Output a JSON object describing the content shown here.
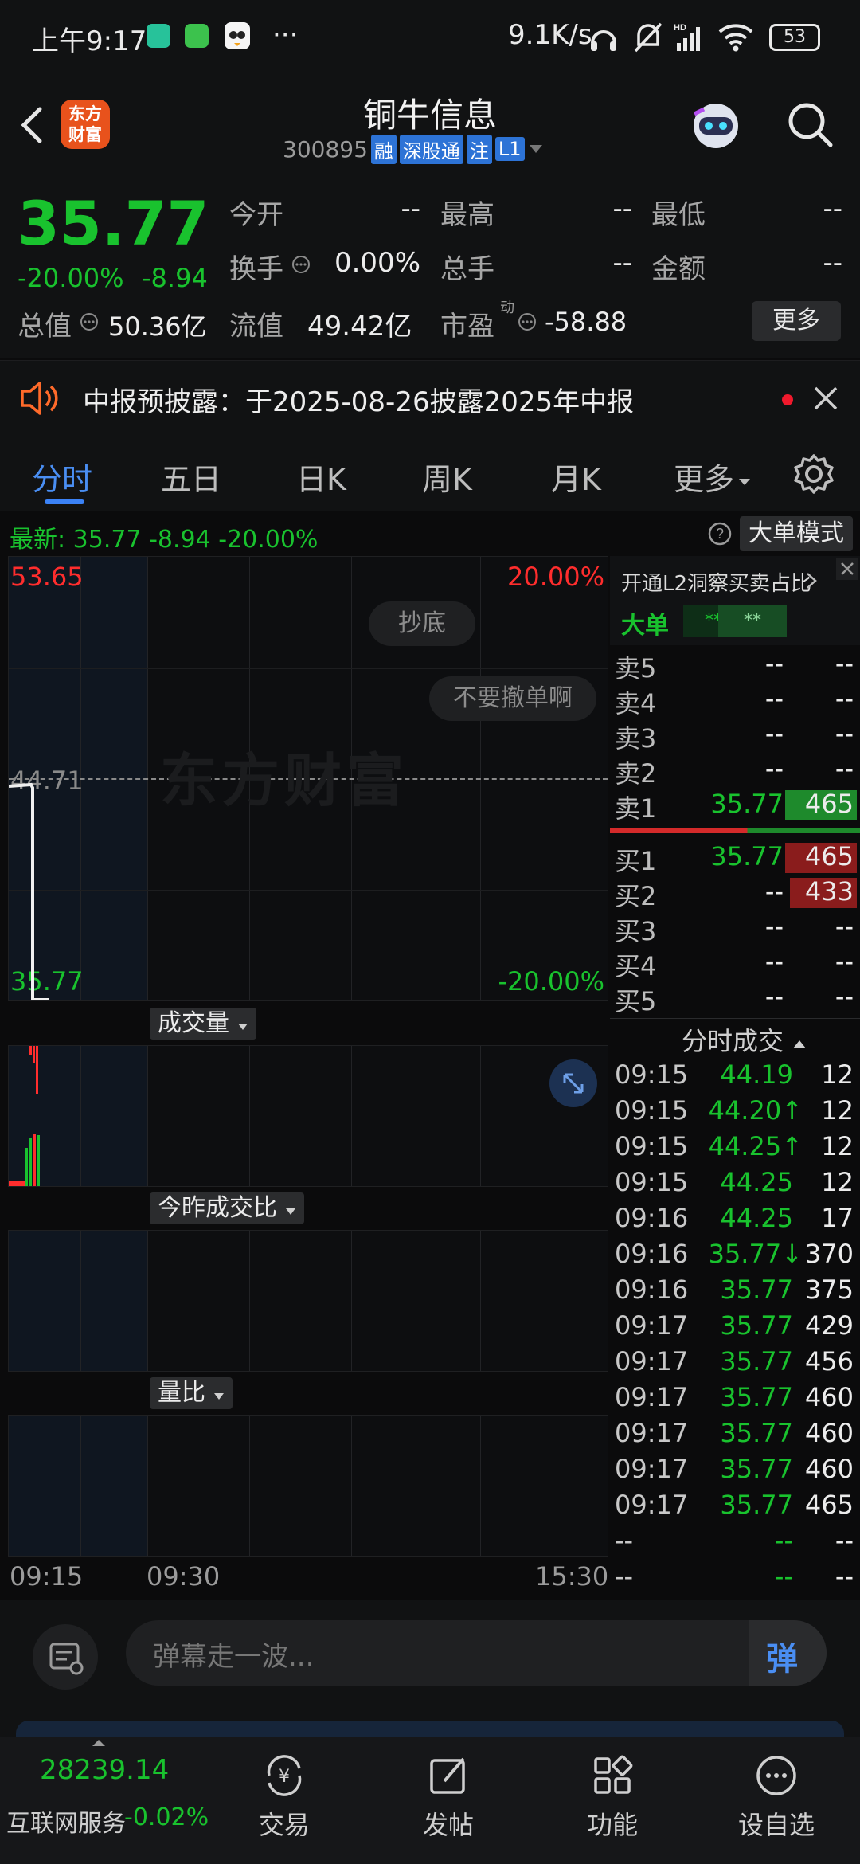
{
  "status": {
    "time": "上午9:17",
    "net_speed": "9.1K/s",
    "battery": "53",
    "dots": "···"
  },
  "header": {
    "stock_name": "铜牛信息",
    "code": "300895",
    "tags": [
      "融",
      "深股通",
      "注",
      "L1"
    ],
    "logo_line1": "东方",
    "logo_line2": "财富"
  },
  "quote": {
    "price": "35.77",
    "change_pct": "-20.00%",
    "change": "-8.94",
    "open_label": "今开",
    "open": "--",
    "high_label": "最高",
    "high": "--",
    "low_label": "最低",
    "low": "--",
    "turnover_label": "换手",
    "turnover": "0.00%",
    "volume_label": "总手",
    "volume": "--",
    "amount_label": "金额",
    "amount": "--",
    "mktcap_label": "总值",
    "mktcap": "50.36亿",
    "float_label": "流值",
    "float": "49.42亿",
    "pe_label": "市盈",
    "pe_sup": "动",
    "pe": "-58.88",
    "more": "更多"
  },
  "notice": {
    "text": "中报预披露：于2025-08-26披露2025年中报"
  },
  "tabs": [
    "分时",
    "五日",
    "日K",
    "周K",
    "月K",
    "更多"
  ],
  "latest": {
    "text": "最新: 35.77  -8.94  -20.00%",
    "big_order_mode": "大单模式"
  },
  "chart": {
    "top_price": "53.65",
    "top_pct": "20.00%",
    "mid_price": "44.71",
    "bottom_price": "35.77",
    "bottom_pct": "-20.00%",
    "watermark": "东方财富",
    "danmu1": "抄底",
    "danmu2": "不要撤单啊",
    "volume_btn": "成交量",
    "ratio_btn": "今昨成交比",
    "qrr_btn": "量比",
    "time_start": "09:15",
    "time_mid": "09:30",
    "time_end": "15:30",
    "colors": {
      "up": "#ff2d2d",
      "down": "#19c22e"
    }
  },
  "book": {
    "l2_link": "开通L2洞察买卖占比",
    "big_single": "大单",
    "big_v1": "**",
    "big_v2": "**",
    "sells": [
      {
        "label": "卖5",
        "price": "--",
        "vol": "--"
      },
      {
        "label": "卖4",
        "price": "--",
        "vol": "--"
      },
      {
        "label": "卖3",
        "price": "--",
        "vol": "--"
      },
      {
        "label": "卖2",
        "price": "--",
        "vol": "--"
      },
      {
        "label": "卖1",
        "price": "35.77",
        "vol": "465"
      }
    ],
    "buys": [
      {
        "label": "买1",
        "price": "35.77",
        "vol": "465"
      },
      {
        "label": "买2",
        "price": "--",
        "vol": "433"
      },
      {
        "label": "买3",
        "price": "--",
        "vol": "--"
      },
      {
        "label": "买4",
        "price": "--",
        "vol": "--"
      },
      {
        "label": "买5",
        "price": "--",
        "vol": "--"
      }
    ],
    "ticks_title": "分时成交",
    "ticks": [
      {
        "t": "09:15",
        "p": "44.19",
        "v": "12"
      },
      {
        "t": "09:15",
        "p": "44.20↑",
        "v": "12"
      },
      {
        "t": "09:15",
        "p": "44.25↑",
        "v": "12"
      },
      {
        "t": "09:15",
        "p": "44.25",
        "v": "12"
      },
      {
        "t": "09:16",
        "p": "44.25",
        "v": "17"
      },
      {
        "t": "09:16",
        "p": "35.77↓",
        "v": "370"
      },
      {
        "t": "09:16",
        "p": "35.77",
        "v": "375"
      },
      {
        "t": "09:17",
        "p": "35.77",
        "v": "429"
      },
      {
        "t": "09:17",
        "p": "35.77",
        "v": "456"
      },
      {
        "t": "09:17",
        "p": "35.77",
        "v": "460"
      },
      {
        "t": "09:17",
        "p": "35.77",
        "v": "460"
      },
      {
        "t": "09:17",
        "p": "35.77",
        "v": "460"
      },
      {
        "t": "09:17",
        "p": "35.77",
        "v": "465"
      },
      {
        "t": "--",
        "p": "--",
        "v": "--"
      },
      {
        "t": "--",
        "p": "--",
        "v": "--"
      }
    ]
  },
  "danmu": {
    "placeholder": "弹幕走一波...",
    "send": "弹"
  },
  "bottom": {
    "index_value": "28239.14",
    "index_name": "互联网服务",
    "index_change": "-0.02%",
    "nav": [
      "交易",
      "发帖",
      "功能",
      "设自选"
    ]
  }
}
